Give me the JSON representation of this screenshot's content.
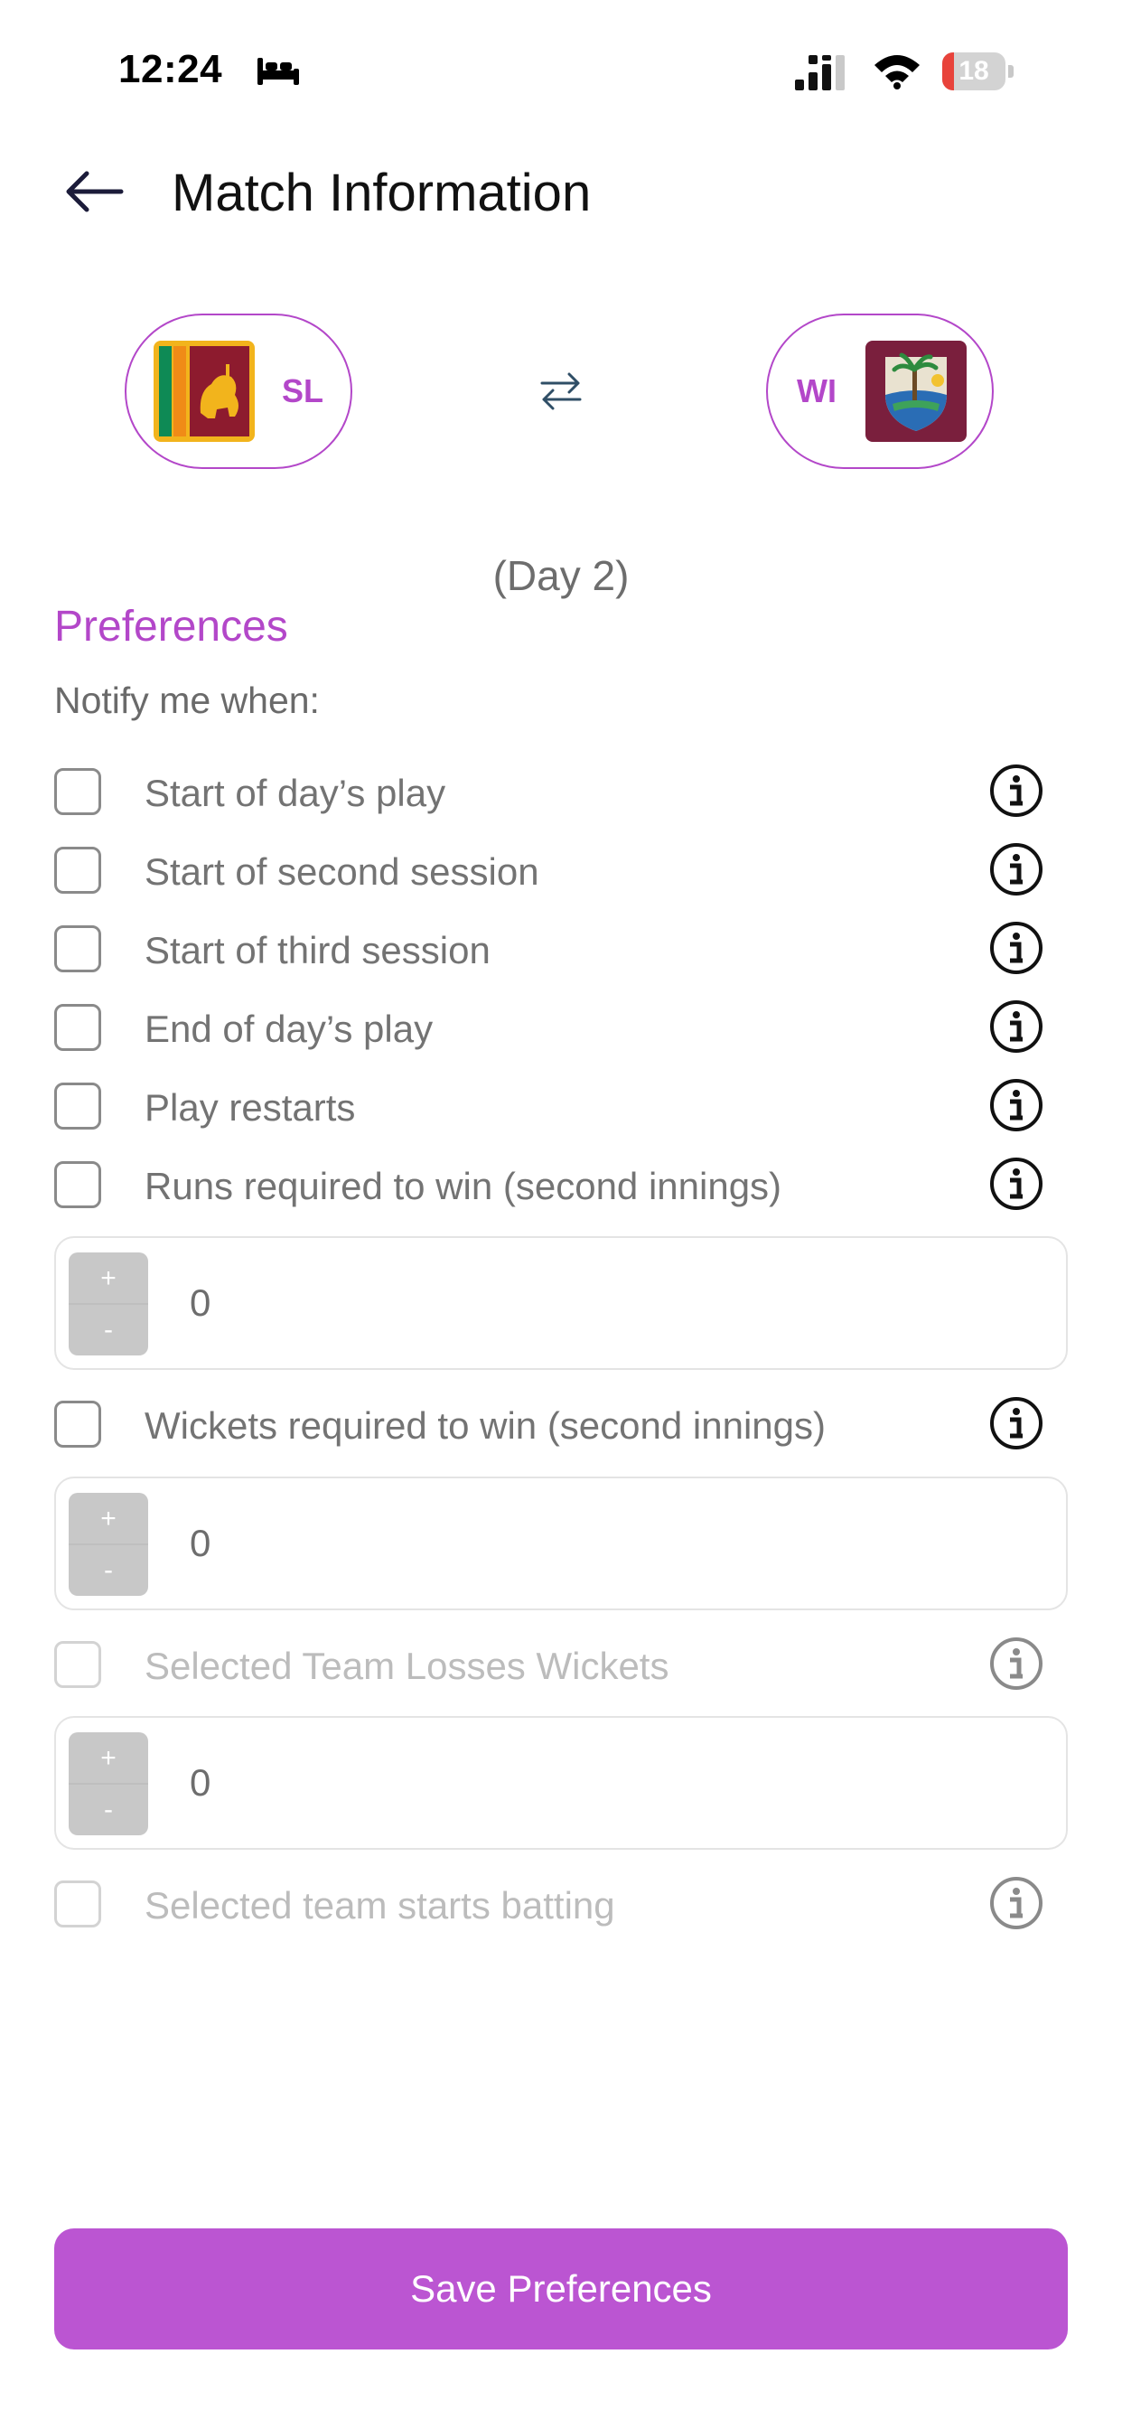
{
  "status_bar": {
    "time": "12:24",
    "battery": "18"
  },
  "header": {
    "title": "Match Information"
  },
  "teams": {
    "home": {
      "code": "SL"
    },
    "away": {
      "code": "WI"
    }
  },
  "match": {
    "day_label": "(Day 2)"
  },
  "preferences": {
    "title": "Preferences",
    "notify_label": "Notify me when:",
    "options": [
      {
        "label": "Start of day’s play",
        "checked": false,
        "enabled": true
      },
      {
        "label": "Start of second session",
        "checked": false,
        "enabled": true
      },
      {
        "label": "Start of third session",
        "checked": false,
        "enabled": true
      },
      {
        "label": "End of day’s play",
        "checked": false,
        "enabled": true
      },
      {
        "label": "Play restarts",
        "checked": false,
        "enabled": true
      },
      {
        "label": "Runs required to win (second innings)",
        "checked": false,
        "enabled": true
      },
      {
        "label": "Wickets required to win (second innings)",
        "checked": false,
        "enabled": true
      },
      {
        "label": "Selected Team Losses Wickets",
        "checked": false,
        "enabled": false
      },
      {
        "label": "Selected team starts batting",
        "checked": false,
        "enabled": false
      }
    ],
    "steppers": [
      {
        "value": "0",
        "plus": "+",
        "minus": "-"
      },
      {
        "value": "0",
        "plus": "+",
        "minus": "-"
      },
      {
        "value": "0",
        "plus": "+",
        "minus": "-"
      }
    ]
  },
  "footer": {
    "save_label": "Save Preferences"
  },
  "colors": {
    "accent": "#b347c9",
    "button": "#bb55d2",
    "battery_low": "#e8433b"
  }
}
